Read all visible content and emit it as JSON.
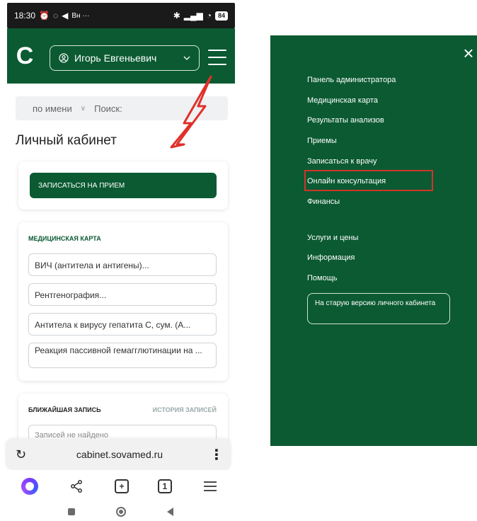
{
  "status_bar": {
    "time": "18:30",
    "extra": "Bн ···",
    "battery": "84"
  },
  "header": {
    "logo": "C",
    "user_name": "Игорь Евгеньевич"
  },
  "search": {
    "sort_label": "по имени",
    "placeholder": "Поиск:"
  },
  "page": {
    "title": "Личный кабинет"
  },
  "appointment_card": {
    "button_label": "ЗАПИСАТЬСЯ НА ПРИЕМ"
  },
  "medical_card": {
    "heading": "МЕДИЦИНСКАЯ КАРТА",
    "items": [
      "ВИЧ (антитела и антигены)...",
      "Рентгенография...",
      "Антитела к вирусу гепатита С, сум. (А...",
      "Реакция пассивной гемагглютинации на ..."
    ]
  },
  "next_appointment": {
    "heading": "БЛИЖАЙШАЯ ЗАПИСЬ",
    "history_link": "ИСТОРИЯ ЗАПИСЕЙ",
    "empty_text": "Записей не найдено"
  },
  "browser": {
    "url": "cabinet.sovamed.ru",
    "tab_count": "1"
  },
  "menu": {
    "items": [
      "Панель администратора",
      "Медицинская карта",
      "Результаты анализов",
      "Приемы",
      "Записаться к врачу",
      "Онлайн консультация",
      "Финансы"
    ],
    "secondary_items": [
      "Услуги и цены",
      "Информация",
      "Помощь"
    ],
    "old_version_button": "На старую версию личного кабинета",
    "highlighted_item": "Онлайн консультация"
  },
  "colors": {
    "brand_green": "#0b5a32",
    "highlight_red": "#d0342c",
    "arrow_red": "#e0302a"
  }
}
